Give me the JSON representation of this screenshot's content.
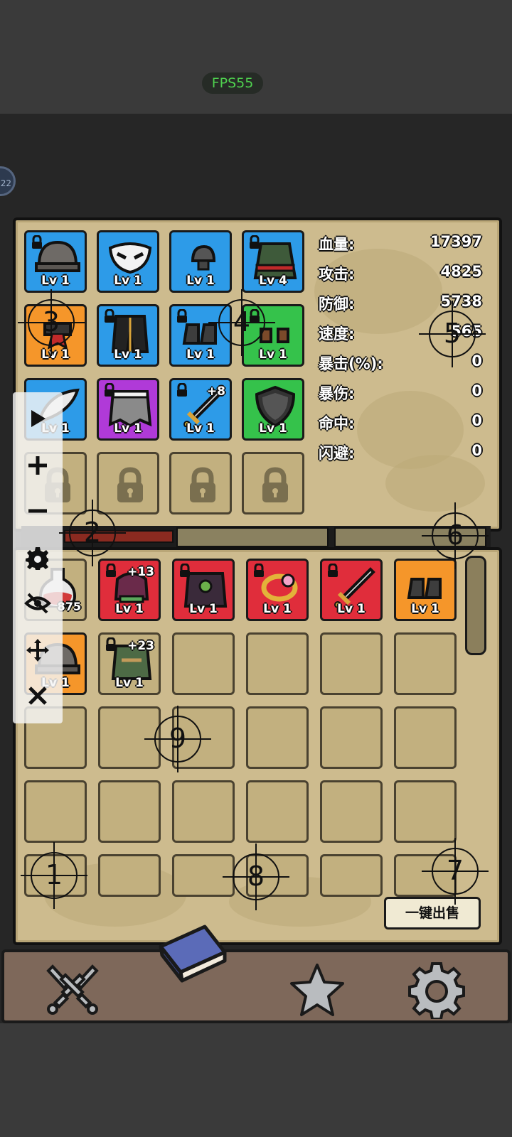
{
  "status": {
    "fps": "FPS55"
  },
  "side_badge": "22",
  "equipment": [
    {
      "quality": "blue",
      "level": "Lv 1",
      "locked": true,
      "item": "helmet",
      "art": "helmet"
    },
    {
      "quality": "blue",
      "level": "Lv 1",
      "locked": false,
      "item": "mask",
      "art": "mask"
    },
    {
      "quality": "blue",
      "level": "Lv 1",
      "locked": false,
      "item": "cap",
      "art": "cap"
    },
    {
      "quality": "blue",
      "level": "Lv 4",
      "locked": true,
      "item": "robe",
      "art": "robe"
    },
    {
      "quality": "orange",
      "level": "Lv 1",
      "locked": false,
      "item": "scarf",
      "art": "scarf"
    },
    {
      "quality": "blue",
      "level": "Lv 1",
      "locked": true,
      "item": "pants",
      "art": "pants"
    },
    {
      "quality": "blue",
      "level": "Lv 1",
      "locked": true,
      "item": "boots",
      "art": "boots"
    },
    {
      "quality": "green",
      "level": "Lv 1",
      "locked": true,
      "item": "gloves",
      "art": "gloves"
    },
    {
      "quality": "blue",
      "level": "Lv 1",
      "locked": false,
      "item": "feather",
      "art": "feather"
    },
    {
      "quality": "purple",
      "level": "Lv 1",
      "locked": true,
      "item": "cape",
      "art": "cape"
    },
    {
      "quality": "blue",
      "level": "Lv 1",
      "locked": true,
      "item": "sword",
      "art": "sword",
      "plus": "+8"
    },
    {
      "quality": "green",
      "level": "Lv 1",
      "locked": false,
      "item": "shield",
      "art": "shield"
    },
    {
      "quality": "locked"
    },
    {
      "quality": "locked"
    },
    {
      "quality": "locked"
    },
    {
      "quality": "locked"
    }
  ],
  "stats": [
    {
      "label": "血量:",
      "value": "17397"
    },
    {
      "label": "攻击:",
      "value": "4825"
    },
    {
      "label": "防御:",
      "value": "5738"
    },
    {
      "label": "速度:",
      "value": "565"
    },
    {
      "label": "暴击(%):",
      "value": "0"
    },
    {
      "label": "暴伤:",
      "value": "0"
    },
    {
      "label": "命中:",
      "value": "0"
    },
    {
      "label": "闪避:",
      "value": "0"
    }
  ],
  "inventory": [
    {
      "quality": "empty",
      "art": "potion",
      "count": "875"
    },
    {
      "quality": "red",
      "level": "Lv 1",
      "locked": true,
      "art": "bag",
      "plus": "+13"
    },
    {
      "quality": "red",
      "level": "Lv 1",
      "locked": true,
      "art": "goblin-armor"
    },
    {
      "quality": "red",
      "level": "Lv 1",
      "locked": true,
      "art": "ring"
    },
    {
      "quality": "red",
      "level": "Lv 1",
      "locked": true,
      "art": "sword"
    },
    {
      "quality": "orange",
      "level": "Lv 1",
      "locked": false,
      "art": "boots"
    },
    {
      "quality": "orange",
      "level": "Lv 1",
      "locked": false,
      "art": "helmet"
    },
    {
      "quality": "empty",
      "level": "Lv 1",
      "locked": true,
      "art": "vest",
      "plus": "+23"
    }
  ],
  "sell_button": "一键出售",
  "nav": [
    {
      "name": "battle",
      "icon": "crossed-swords-icon"
    },
    {
      "name": "book",
      "icon": "book-icon"
    },
    {
      "name": "favorites",
      "icon": "star-icon"
    },
    {
      "name": "settings",
      "icon": "gear-icon"
    }
  ],
  "markers": [
    "1",
    "2",
    "3",
    "4",
    "5",
    "6",
    "7",
    "8",
    "9"
  ]
}
